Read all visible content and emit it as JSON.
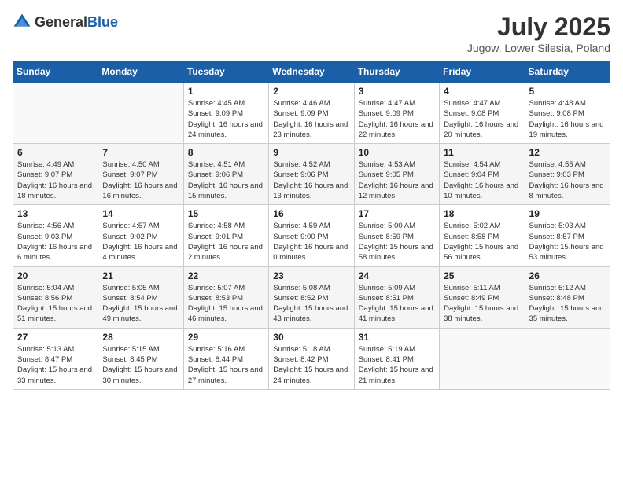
{
  "header": {
    "logo_general": "General",
    "logo_blue": "Blue",
    "month": "July 2025",
    "location": "Jugow, Lower Silesia, Poland"
  },
  "weekdays": [
    "Sunday",
    "Monday",
    "Tuesday",
    "Wednesday",
    "Thursday",
    "Friday",
    "Saturday"
  ],
  "weeks": [
    [
      {
        "day": "",
        "info": ""
      },
      {
        "day": "",
        "info": ""
      },
      {
        "day": "1",
        "info": "Sunrise: 4:45 AM\nSunset: 9:09 PM\nDaylight: 16 hours and 24 minutes."
      },
      {
        "day": "2",
        "info": "Sunrise: 4:46 AM\nSunset: 9:09 PM\nDaylight: 16 hours and 23 minutes."
      },
      {
        "day": "3",
        "info": "Sunrise: 4:47 AM\nSunset: 9:09 PM\nDaylight: 16 hours and 22 minutes."
      },
      {
        "day": "4",
        "info": "Sunrise: 4:47 AM\nSunset: 9:08 PM\nDaylight: 16 hours and 20 minutes."
      },
      {
        "day": "5",
        "info": "Sunrise: 4:48 AM\nSunset: 9:08 PM\nDaylight: 16 hours and 19 minutes."
      }
    ],
    [
      {
        "day": "6",
        "info": "Sunrise: 4:49 AM\nSunset: 9:07 PM\nDaylight: 16 hours and 18 minutes."
      },
      {
        "day": "7",
        "info": "Sunrise: 4:50 AM\nSunset: 9:07 PM\nDaylight: 16 hours and 16 minutes."
      },
      {
        "day": "8",
        "info": "Sunrise: 4:51 AM\nSunset: 9:06 PM\nDaylight: 16 hours and 15 minutes."
      },
      {
        "day": "9",
        "info": "Sunrise: 4:52 AM\nSunset: 9:06 PM\nDaylight: 16 hours and 13 minutes."
      },
      {
        "day": "10",
        "info": "Sunrise: 4:53 AM\nSunset: 9:05 PM\nDaylight: 16 hours and 12 minutes."
      },
      {
        "day": "11",
        "info": "Sunrise: 4:54 AM\nSunset: 9:04 PM\nDaylight: 16 hours and 10 minutes."
      },
      {
        "day": "12",
        "info": "Sunrise: 4:55 AM\nSunset: 9:03 PM\nDaylight: 16 hours and 8 minutes."
      }
    ],
    [
      {
        "day": "13",
        "info": "Sunrise: 4:56 AM\nSunset: 9:03 PM\nDaylight: 16 hours and 6 minutes."
      },
      {
        "day": "14",
        "info": "Sunrise: 4:57 AM\nSunset: 9:02 PM\nDaylight: 16 hours and 4 minutes."
      },
      {
        "day": "15",
        "info": "Sunrise: 4:58 AM\nSunset: 9:01 PM\nDaylight: 16 hours and 2 minutes."
      },
      {
        "day": "16",
        "info": "Sunrise: 4:59 AM\nSunset: 9:00 PM\nDaylight: 16 hours and 0 minutes."
      },
      {
        "day": "17",
        "info": "Sunrise: 5:00 AM\nSunset: 8:59 PM\nDaylight: 15 hours and 58 minutes."
      },
      {
        "day": "18",
        "info": "Sunrise: 5:02 AM\nSunset: 8:58 PM\nDaylight: 15 hours and 56 minutes."
      },
      {
        "day": "19",
        "info": "Sunrise: 5:03 AM\nSunset: 8:57 PM\nDaylight: 15 hours and 53 minutes."
      }
    ],
    [
      {
        "day": "20",
        "info": "Sunrise: 5:04 AM\nSunset: 8:56 PM\nDaylight: 15 hours and 51 minutes."
      },
      {
        "day": "21",
        "info": "Sunrise: 5:05 AM\nSunset: 8:54 PM\nDaylight: 15 hours and 49 minutes."
      },
      {
        "day": "22",
        "info": "Sunrise: 5:07 AM\nSunset: 8:53 PM\nDaylight: 15 hours and 46 minutes."
      },
      {
        "day": "23",
        "info": "Sunrise: 5:08 AM\nSunset: 8:52 PM\nDaylight: 15 hours and 43 minutes."
      },
      {
        "day": "24",
        "info": "Sunrise: 5:09 AM\nSunset: 8:51 PM\nDaylight: 15 hours and 41 minutes."
      },
      {
        "day": "25",
        "info": "Sunrise: 5:11 AM\nSunset: 8:49 PM\nDaylight: 15 hours and 38 minutes."
      },
      {
        "day": "26",
        "info": "Sunrise: 5:12 AM\nSunset: 8:48 PM\nDaylight: 15 hours and 35 minutes."
      }
    ],
    [
      {
        "day": "27",
        "info": "Sunrise: 5:13 AM\nSunset: 8:47 PM\nDaylight: 15 hours and 33 minutes."
      },
      {
        "day": "28",
        "info": "Sunrise: 5:15 AM\nSunset: 8:45 PM\nDaylight: 15 hours and 30 minutes."
      },
      {
        "day": "29",
        "info": "Sunrise: 5:16 AM\nSunset: 8:44 PM\nDaylight: 15 hours and 27 minutes."
      },
      {
        "day": "30",
        "info": "Sunrise: 5:18 AM\nSunset: 8:42 PM\nDaylight: 15 hours and 24 minutes."
      },
      {
        "day": "31",
        "info": "Sunrise: 5:19 AM\nSunset: 8:41 PM\nDaylight: 15 hours and 21 minutes."
      },
      {
        "day": "",
        "info": ""
      },
      {
        "day": "",
        "info": ""
      }
    ]
  ]
}
